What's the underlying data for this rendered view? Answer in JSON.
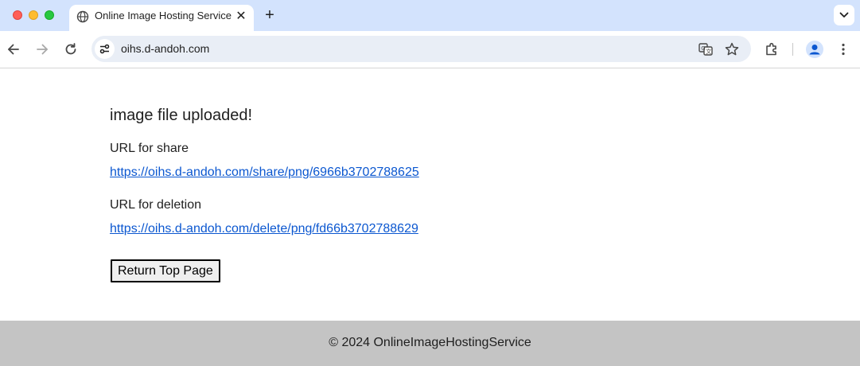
{
  "browser": {
    "tab": {
      "title": "Online Image Hosting Service",
      "close_glyph": "✕"
    },
    "new_tab_glyph": "+",
    "address_bar": {
      "url": "oihs.d-andoh.com"
    }
  },
  "page": {
    "heading": "image file uploaded!",
    "share": {
      "label": "URL for share",
      "url": "https://oihs.d-andoh.com/share/png/6966b3702788625"
    },
    "deletion": {
      "label": "URL for deletion",
      "url": "https://oihs.d-andoh.com/delete/png/fd66b3702788629"
    },
    "return_button": "Return Top Page"
  },
  "footer": {
    "text": "© 2024 OnlineImageHostingService"
  },
  "colors": {
    "tabstrip": "#d3e3fd",
    "link": "#0b57d0",
    "footer_bg": "#c4c4c4"
  },
  "icons": [
    "globe-icon",
    "close-icon",
    "plus-icon",
    "chevron-down-icon",
    "back-arrow-icon",
    "forward-arrow-icon",
    "reload-icon",
    "site-settings-icon",
    "translate-icon",
    "star-icon",
    "extensions-icon",
    "profile-icon",
    "more-vert-icon"
  ]
}
